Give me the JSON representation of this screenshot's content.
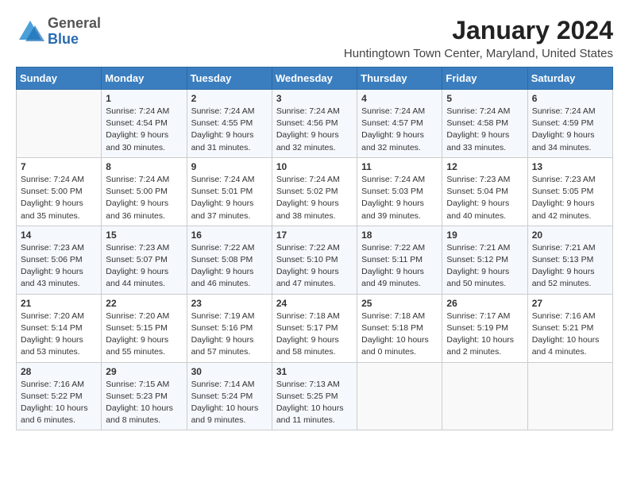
{
  "header": {
    "logo_general": "General",
    "logo_blue": "Blue",
    "month": "January 2024",
    "location": "Huntingtown Town Center, Maryland, United States"
  },
  "days_of_week": [
    "Sunday",
    "Monday",
    "Tuesday",
    "Wednesday",
    "Thursday",
    "Friday",
    "Saturday"
  ],
  "weeks": [
    [
      {
        "day": "",
        "sunrise": "",
        "sunset": "",
        "daylight": ""
      },
      {
        "day": "1",
        "sunrise": "Sunrise: 7:24 AM",
        "sunset": "Sunset: 4:54 PM",
        "daylight": "Daylight: 9 hours and 30 minutes."
      },
      {
        "day": "2",
        "sunrise": "Sunrise: 7:24 AM",
        "sunset": "Sunset: 4:55 PM",
        "daylight": "Daylight: 9 hours and 31 minutes."
      },
      {
        "day": "3",
        "sunrise": "Sunrise: 7:24 AM",
        "sunset": "Sunset: 4:56 PM",
        "daylight": "Daylight: 9 hours and 32 minutes."
      },
      {
        "day": "4",
        "sunrise": "Sunrise: 7:24 AM",
        "sunset": "Sunset: 4:57 PM",
        "daylight": "Daylight: 9 hours and 32 minutes."
      },
      {
        "day": "5",
        "sunrise": "Sunrise: 7:24 AM",
        "sunset": "Sunset: 4:58 PM",
        "daylight": "Daylight: 9 hours and 33 minutes."
      },
      {
        "day": "6",
        "sunrise": "Sunrise: 7:24 AM",
        "sunset": "Sunset: 4:59 PM",
        "daylight": "Daylight: 9 hours and 34 minutes."
      }
    ],
    [
      {
        "day": "7",
        "sunrise": "Sunrise: 7:24 AM",
        "sunset": "Sunset: 5:00 PM",
        "daylight": "Daylight: 9 hours and 35 minutes."
      },
      {
        "day": "8",
        "sunrise": "Sunrise: 7:24 AM",
        "sunset": "Sunset: 5:00 PM",
        "daylight": "Daylight: 9 hours and 36 minutes."
      },
      {
        "day": "9",
        "sunrise": "Sunrise: 7:24 AM",
        "sunset": "Sunset: 5:01 PM",
        "daylight": "Daylight: 9 hours and 37 minutes."
      },
      {
        "day": "10",
        "sunrise": "Sunrise: 7:24 AM",
        "sunset": "Sunset: 5:02 PM",
        "daylight": "Daylight: 9 hours and 38 minutes."
      },
      {
        "day": "11",
        "sunrise": "Sunrise: 7:24 AM",
        "sunset": "Sunset: 5:03 PM",
        "daylight": "Daylight: 9 hours and 39 minutes."
      },
      {
        "day": "12",
        "sunrise": "Sunrise: 7:23 AM",
        "sunset": "Sunset: 5:04 PM",
        "daylight": "Daylight: 9 hours and 40 minutes."
      },
      {
        "day": "13",
        "sunrise": "Sunrise: 7:23 AM",
        "sunset": "Sunset: 5:05 PM",
        "daylight": "Daylight: 9 hours and 42 minutes."
      }
    ],
    [
      {
        "day": "14",
        "sunrise": "Sunrise: 7:23 AM",
        "sunset": "Sunset: 5:06 PM",
        "daylight": "Daylight: 9 hours and 43 minutes."
      },
      {
        "day": "15",
        "sunrise": "Sunrise: 7:23 AM",
        "sunset": "Sunset: 5:07 PM",
        "daylight": "Daylight: 9 hours and 44 minutes."
      },
      {
        "day": "16",
        "sunrise": "Sunrise: 7:22 AM",
        "sunset": "Sunset: 5:08 PM",
        "daylight": "Daylight: 9 hours and 46 minutes."
      },
      {
        "day": "17",
        "sunrise": "Sunrise: 7:22 AM",
        "sunset": "Sunset: 5:10 PM",
        "daylight": "Daylight: 9 hours and 47 minutes."
      },
      {
        "day": "18",
        "sunrise": "Sunrise: 7:22 AM",
        "sunset": "Sunset: 5:11 PM",
        "daylight": "Daylight: 9 hours and 49 minutes."
      },
      {
        "day": "19",
        "sunrise": "Sunrise: 7:21 AM",
        "sunset": "Sunset: 5:12 PM",
        "daylight": "Daylight: 9 hours and 50 minutes."
      },
      {
        "day": "20",
        "sunrise": "Sunrise: 7:21 AM",
        "sunset": "Sunset: 5:13 PM",
        "daylight": "Daylight: 9 hours and 52 minutes."
      }
    ],
    [
      {
        "day": "21",
        "sunrise": "Sunrise: 7:20 AM",
        "sunset": "Sunset: 5:14 PM",
        "daylight": "Daylight: 9 hours and 53 minutes."
      },
      {
        "day": "22",
        "sunrise": "Sunrise: 7:20 AM",
        "sunset": "Sunset: 5:15 PM",
        "daylight": "Daylight: 9 hours and 55 minutes."
      },
      {
        "day": "23",
        "sunrise": "Sunrise: 7:19 AM",
        "sunset": "Sunset: 5:16 PM",
        "daylight": "Daylight: 9 hours and 57 minutes."
      },
      {
        "day": "24",
        "sunrise": "Sunrise: 7:18 AM",
        "sunset": "Sunset: 5:17 PM",
        "daylight": "Daylight: 9 hours and 58 minutes."
      },
      {
        "day": "25",
        "sunrise": "Sunrise: 7:18 AM",
        "sunset": "Sunset: 5:18 PM",
        "daylight": "Daylight: 10 hours and 0 minutes."
      },
      {
        "day": "26",
        "sunrise": "Sunrise: 7:17 AM",
        "sunset": "Sunset: 5:19 PM",
        "daylight": "Daylight: 10 hours and 2 minutes."
      },
      {
        "day": "27",
        "sunrise": "Sunrise: 7:16 AM",
        "sunset": "Sunset: 5:21 PM",
        "daylight": "Daylight: 10 hours and 4 minutes."
      }
    ],
    [
      {
        "day": "28",
        "sunrise": "Sunrise: 7:16 AM",
        "sunset": "Sunset: 5:22 PM",
        "daylight": "Daylight: 10 hours and 6 minutes."
      },
      {
        "day": "29",
        "sunrise": "Sunrise: 7:15 AM",
        "sunset": "Sunset: 5:23 PM",
        "daylight": "Daylight: 10 hours and 8 minutes."
      },
      {
        "day": "30",
        "sunrise": "Sunrise: 7:14 AM",
        "sunset": "Sunset: 5:24 PM",
        "daylight": "Daylight: 10 hours and 9 minutes."
      },
      {
        "day": "31",
        "sunrise": "Sunrise: 7:13 AM",
        "sunset": "Sunset: 5:25 PM",
        "daylight": "Daylight: 10 hours and 11 minutes."
      },
      {
        "day": "",
        "sunrise": "",
        "sunset": "",
        "daylight": ""
      },
      {
        "day": "",
        "sunrise": "",
        "sunset": "",
        "daylight": ""
      },
      {
        "day": "",
        "sunrise": "",
        "sunset": "",
        "daylight": ""
      }
    ]
  ]
}
